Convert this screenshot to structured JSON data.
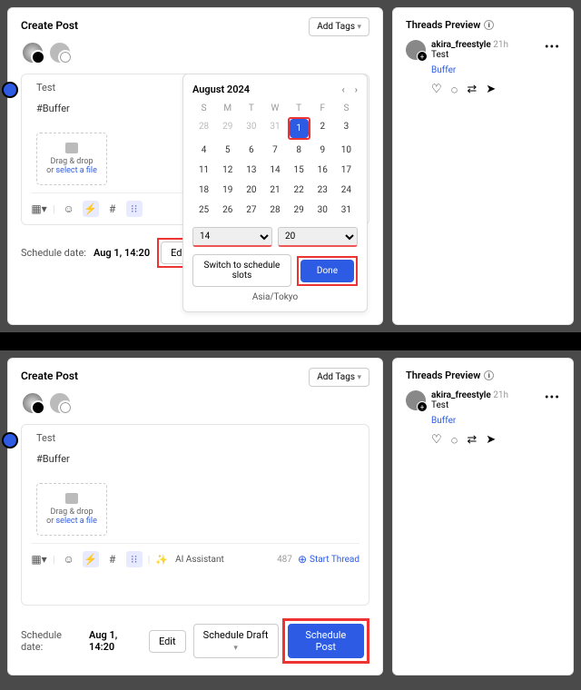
{
  "createPost": {
    "title": "Create Post",
    "addTags": "Add Tags",
    "text1": "Test",
    "text2": "#Buffer",
    "dropzone": {
      "line1": "Drag & drop",
      "line2": "or ",
      "link": "select a file"
    },
    "aiAssistant": "AI Assistant",
    "charCount": "487",
    "startThread": "Start Thread",
    "scheduleLabel": "Schedule date:",
    "scheduleDate": "Aug 1, 14:20",
    "editBtn": "Edit",
    "scheduleDraft": "Schedule Draft",
    "schedulePost": "Schedule Post"
  },
  "datepicker": {
    "month": "August 2024",
    "dow": [
      "S",
      "M",
      "T",
      "W",
      "T",
      "F",
      "S"
    ],
    "rows": [
      [
        "28",
        "29",
        "30",
        "31",
        "1",
        "2",
        "3"
      ],
      [
        "4",
        "5",
        "6",
        "7",
        "8",
        "9",
        "10"
      ],
      [
        "11",
        "12",
        "13",
        "14",
        "15",
        "16",
        "17"
      ],
      [
        "18",
        "19",
        "20",
        "21",
        "22",
        "23",
        "24"
      ],
      [
        "25",
        "26",
        "27",
        "28",
        "29",
        "30",
        "31"
      ]
    ],
    "prevCount": 4,
    "selected": "1",
    "hour": "14",
    "minute": "20",
    "switch": "Switch to schedule slots",
    "done": "Done",
    "tz": "Asia/Tokyo"
  },
  "preview": {
    "title": "Threads Preview",
    "user": "akira_freestyle",
    "time": "21h",
    "text": "Test",
    "buffer": "Buffer"
  }
}
